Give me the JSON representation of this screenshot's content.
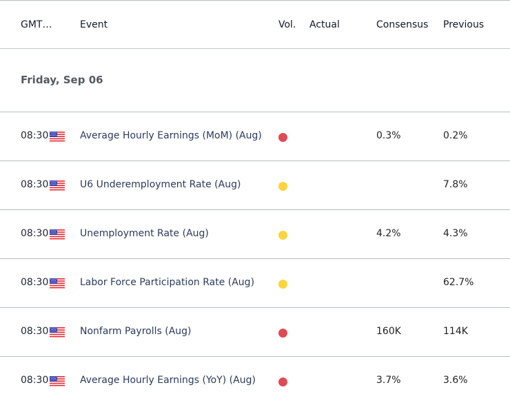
{
  "header": {
    "time_label": "GMT…",
    "event_label": "Event",
    "vol_label": "Vol.",
    "actual_label": "Actual",
    "consensus_label": "Consensus",
    "previous_label": "Previous"
  },
  "day": "Friday, Sep 06",
  "colors": {
    "high": "#e04a55",
    "medium": "#fdd43c"
  },
  "events": [
    {
      "time": "08:30",
      "country": "US",
      "flag_icon": "us-flag-icon",
      "event": "Average Hourly Earnings (MoM) (Aug)",
      "volatility": "high",
      "actual": "",
      "consensus": "0.3%",
      "previous": "0.2%"
    },
    {
      "time": "08:30",
      "country": "US",
      "flag_icon": "us-flag-icon",
      "event": "U6 Underemployment Rate (Aug)",
      "volatility": "medium",
      "actual": "",
      "consensus": "",
      "previous": "7.8%"
    },
    {
      "time": "08:30",
      "country": "US",
      "flag_icon": "us-flag-icon",
      "event": "Unemployment Rate (Aug)",
      "volatility": "medium",
      "actual": "",
      "consensus": "4.2%",
      "previous": "4.3%"
    },
    {
      "time": "08:30",
      "country": "US",
      "flag_icon": "us-flag-icon",
      "event": "Labor Force Participation Rate (Aug)",
      "volatility": "medium",
      "actual": "",
      "consensus": "",
      "previous": "62.7%"
    },
    {
      "time": "08:30",
      "country": "US",
      "flag_icon": "us-flag-icon",
      "event": "Nonfarm Payrolls (Aug)",
      "volatility": "high",
      "actual": "",
      "consensus": "160K",
      "previous": "114K"
    },
    {
      "time": "08:30",
      "country": "US",
      "flag_icon": "us-flag-icon",
      "event": "Average Hourly Earnings (YoY) (Aug)",
      "volatility": "high",
      "actual": "",
      "consensus": "3.7%",
      "previous": "3.6%"
    }
  ]
}
